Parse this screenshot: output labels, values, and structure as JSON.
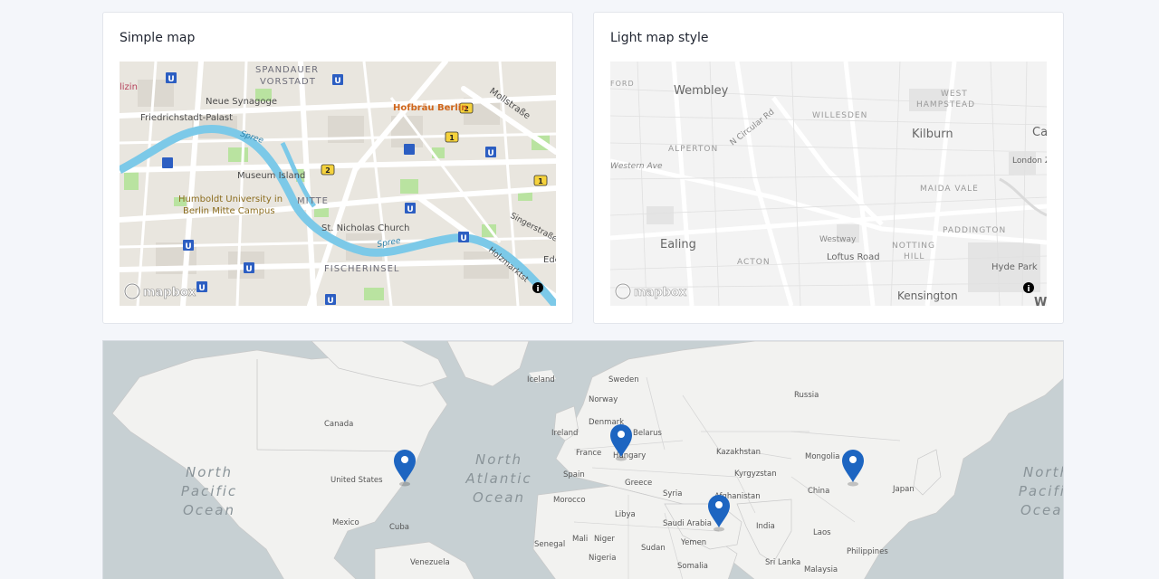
{
  "cards": {
    "simple": {
      "title": "Simple map"
    },
    "light": {
      "title": "Light map style"
    }
  },
  "simple_map": {
    "labels": {
      "spandauer": "SPANDAUER",
      "vorstadt": "VORSTADT",
      "neue_synagoge": "Neue Synagoge",
      "friedrichstadt": "Friedrichstadt-Palast",
      "hofbrau": "Hofbräu Berlin",
      "mollstrasse": "Mollstraße",
      "spree1": "Spree",
      "spree2": "Spree",
      "museum_island": "Museum Island",
      "humboldt1": "Humboldt University in",
      "humboldt2": "Berlin Mitte Campus",
      "mitte": "MITTE",
      "nicholas": "St. Nicholas Church",
      "singerstrasse": "Singerstraße",
      "holzmarkt": "Holzmarktst",
      "fischerinsel": "FISCHERINSEL",
      "izin": "lizin",
      "ed": "Ede",
      "badge1": "2",
      "badge2": "1",
      "badge3": "2",
      "badge4": "1"
    },
    "attribution": "mapbox",
    "info_icon": "info-icon"
  },
  "light_map": {
    "labels": {
      "wembley": "Wembley",
      "ford": "FORD",
      "west": "WEST",
      "hampstead": "HAMPSTEAD",
      "willesden": "WILLESDEN",
      "circular": "N Circular Rd",
      "alperton": "ALPERTON",
      "kilburn": "Kilburn",
      "ca": "Ca",
      "london": "London Z",
      "western": "Western Ave",
      "maida": "MAIDA VALE",
      "paddington": "PADDINGTON",
      "ealing": "Ealing",
      "westway": "Westway",
      "notting": "NOTTING",
      "hill": "HILL",
      "acton": "ACTON",
      "loftus": "Loftus Road",
      "hyde": "Hyde Park",
      "kensington": "Kensington",
      "w": "W"
    },
    "attribution": "mapbox",
    "info_icon": "info-icon"
  },
  "world_map": {
    "labels": {
      "iceland": "Iceland",
      "sweden": "Sweden",
      "norway": "Norway",
      "russia": "Russia",
      "canada": "Canada",
      "denmark": "Denmark",
      "belarus": "Belarus",
      "ireland": "Ireland",
      "france": "France",
      "hungary": "Hungary",
      "kazakhstan": "Kazakhstan",
      "mongolia": "Mongolia",
      "united_states": "United States",
      "spain": "Spain",
      "greece": "Greece",
      "kyrgyzstan": "Kyrgyzstan",
      "syria": "Syria",
      "afghanistan": "Afghanistan",
      "china": "China",
      "japan": "Japan",
      "morocco": "Morocco",
      "mexico": "Mexico",
      "cuba": "Cuba",
      "libya": "Libya",
      "saudi": "Saudi Arabia",
      "india": "India",
      "laos": "Laos",
      "senegal": "Senegal",
      "mali": "Mali",
      "niger": "Niger",
      "sudan": "Sudan",
      "yemen": "Yemen",
      "philippines": "Philippines",
      "nigeria": "Nigeria",
      "venezuela": "Venezuela",
      "somalia": "Somalia",
      "sri_lanka": "Sri Lanka",
      "malaysia": "Malaysia",
      "npo1": "North",
      "npo2": "Pacific",
      "npo3": "Ocean",
      "nao1": "North",
      "nao2": "Atlantic",
      "nao3": "Ocean",
      "npo_e1": "North",
      "npo_e2": "Pacific",
      "npo_e3": "Ocean"
    },
    "markers": [
      {
        "name": "marker-new-york",
        "icon": "map-pin-icon"
      },
      {
        "name": "marker-hungary",
        "icon": "map-pin-icon"
      },
      {
        "name": "marker-oman",
        "icon": "map-pin-icon"
      },
      {
        "name": "marker-china",
        "icon": "map-pin-icon"
      }
    ],
    "colors": {
      "marker": "#1d65c1",
      "water": "#c7d0d3",
      "land": "#f2f2f0"
    }
  }
}
